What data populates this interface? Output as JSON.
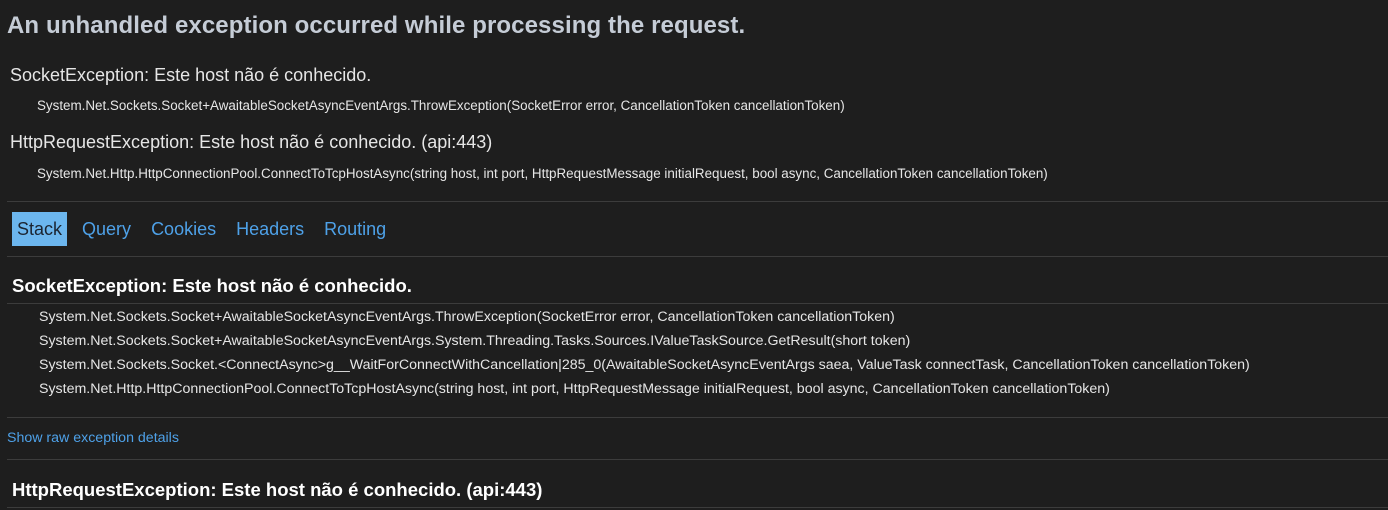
{
  "page": {
    "title": "An unhandled exception occurred while processing the request."
  },
  "summary": [
    {
      "heading": "SocketException: Este host não é conhecido.",
      "frame": "System.Net.Sockets.Socket+AwaitableSocketAsyncEventArgs.ThrowException(SocketError error, CancellationToken cancellationToken)"
    },
    {
      "heading": "HttpRequestException: Este host não é conhecido. (api:443)",
      "frame": "System.Net.Http.HttpConnectionPool.ConnectToTcpHostAsync(string host, int port, HttpRequestMessage initialRequest, bool async, CancellationToken cancellationToken)"
    }
  ],
  "tabs": [
    "Stack",
    "Query",
    "Cookies",
    "Headers",
    "Routing"
  ],
  "active_tab": "Stack",
  "stack": [
    {
      "title": "SocketException: Este host não é conhecido.",
      "frames": [
        "System.Net.Sockets.Socket+AwaitableSocketAsyncEventArgs.ThrowException(SocketError error, CancellationToken cancellationToken)",
        "System.Net.Sockets.Socket+AwaitableSocketAsyncEventArgs.System.Threading.Tasks.Sources.IValueTaskSource.GetResult(short token)",
        "System.Net.Sockets.Socket.<ConnectAsync>g__WaitForConnectWithCancellation|285_0(AwaitableSocketAsyncEventArgs saea, ValueTask connectTask, CancellationToken cancellationToken)",
        "System.Net.Http.HttpConnectionPool.ConnectToTcpHostAsync(string host, int port, HttpRequestMessage initialRequest, bool async, CancellationToken cancellationToken)"
      ],
      "raw_link": "Show raw exception details"
    },
    {
      "title": "HttpRequestException: Este host não é conhecido. (api:443)"
    }
  ]
}
